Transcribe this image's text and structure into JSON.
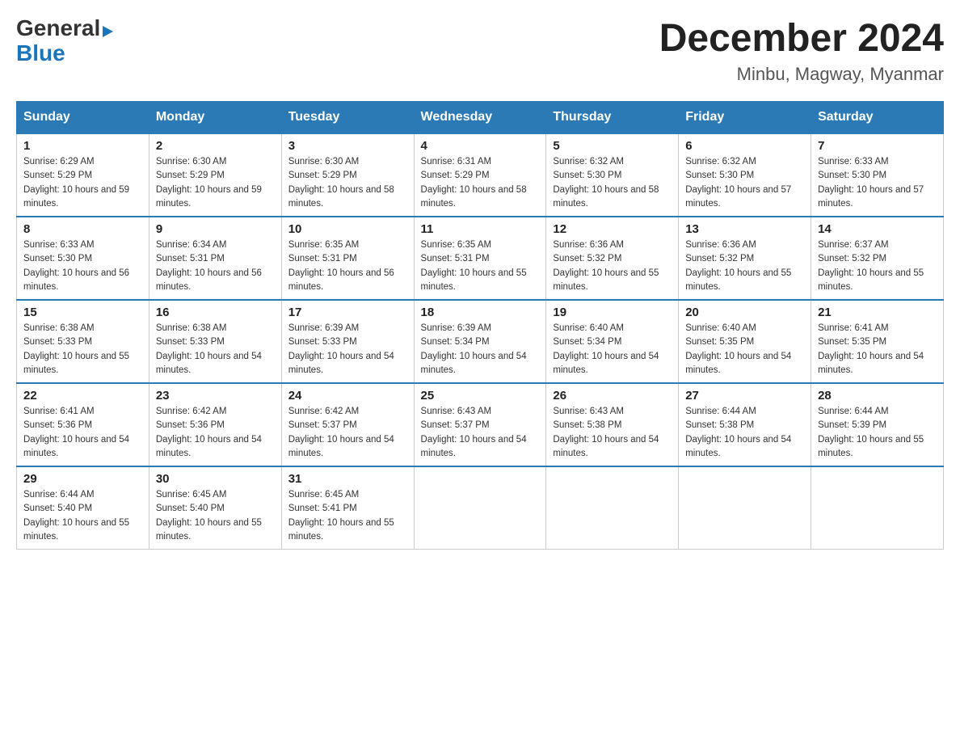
{
  "header": {
    "logo": {
      "general": "General",
      "arrow": "▶",
      "blue": "Blue"
    },
    "title": "December 2024",
    "location": "Minbu, Magway, Myanmar"
  },
  "weekdays": [
    "Sunday",
    "Monday",
    "Tuesday",
    "Wednesday",
    "Thursday",
    "Friday",
    "Saturday"
  ],
  "weeks": [
    [
      {
        "day": "1",
        "sunrise": "6:29 AM",
        "sunset": "5:29 PM",
        "daylight": "10 hours and 59 minutes."
      },
      {
        "day": "2",
        "sunrise": "6:30 AM",
        "sunset": "5:29 PM",
        "daylight": "10 hours and 59 minutes."
      },
      {
        "day": "3",
        "sunrise": "6:30 AM",
        "sunset": "5:29 PM",
        "daylight": "10 hours and 58 minutes."
      },
      {
        "day": "4",
        "sunrise": "6:31 AM",
        "sunset": "5:29 PM",
        "daylight": "10 hours and 58 minutes."
      },
      {
        "day": "5",
        "sunrise": "6:32 AM",
        "sunset": "5:30 PM",
        "daylight": "10 hours and 58 minutes."
      },
      {
        "day": "6",
        "sunrise": "6:32 AM",
        "sunset": "5:30 PM",
        "daylight": "10 hours and 57 minutes."
      },
      {
        "day": "7",
        "sunrise": "6:33 AM",
        "sunset": "5:30 PM",
        "daylight": "10 hours and 57 minutes."
      }
    ],
    [
      {
        "day": "8",
        "sunrise": "6:33 AM",
        "sunset": "5:30 PM",
        "daylight": "10 hours and 56 minutes."
      },
      {
        "day": "9",
        "sunrise": "6:34 AM",
        "sunset": "5:31 PM",
        "daylight": "10 hours and 56 minutes."
      },
      {
        "day": "10",
        "sunrise": "6:35 AM",
        "sunset": "5:31 PM",
        "daylight": "10 hours and 56 minutes."
      },
      {
        "day": "11",
        "sunrise": "6:35 AM",
        "sunset": "5:31 PM",
        "daylight": "10 hours and 55 minutes."
      },
      {
        "day": "12",
        "sunrise": "6:36 AM",
        "sunset": "5:32 PM",
        "daylight": "10 hours and 55 minutes."
      },
      {
        "day": "13",
        "sunrise": "6:36 AM",
        "sunset": "5:32 PM",
        "daylight": "10 hours and 55 minutes."
      },
      {
        "day": "14",
        "sunrise": "6:37 AM",
        "sunset": "5:32 PM",
        "daylight": "10 hours and 55 minutes."
      }
    ],
    [
      {
        "day": "15",
        "sunrise": "6:38 AM",
        "sunset": "5:33 PM",
        "daylight": "10 hours and 55 minutes."
      },
      {
        "day": "16",
        "sunrise": "6:38 AM",
        "sunset": "5:33 PM",
        "daylight": "10 hours and 54 minutes."
      },
      {
        "day": "17",
        "sunrise": "6:39 AM",
        "sunset": "5:33 PM",
        "daylight": "10 hours and 54 minutes."
      },
      {
        "day": "18",
        "sunrise": "6:39 AM",
        "sunset": "5:34 PM",
        "daylight": "10 hours and 54 minutes."
      },
      {
        "day": "19",
        "sunrise": "6:40 AM",
        "sunset": "5:34 PM",
        "daylight": "10 hours and 54 minutes."
      },
      {
        "day": "20",
        "sunrise": "6:40 AM",
        "sunset": "5:35 PM",
        "daylight": "10 hours and 54 minutes."
      },
      {
        "day": "21",
        "sunrise": "6:41 AM",
        "sunset": "5:35 PM",
        "daylight": "10 hours and 54 minutes."
      }
    ],
    [
      {
        "day": "22",
        "sunrise": "6:41 AM",
        "sunset": "5:36 PM",
        "daylight": "10 hours and 54 minutes."
      },
      {
        "day": "23",
        "sunrise": "6:42 AM",
        "sunset": "5:36 PM",
        "daylight": "10 hours and 54 minutes."
      },
      {
        "day": "24",
        "sunrise": "6:42 AM",
        "sunset": "5:37 PM",
        "daylight": "10 hours and 54 minutes."
      },
      {
        "day": "25",
        "sunrise": "6:43 AM",
        "sunset": "5:37 PM",
        "daylight": "10 hours and 54 minutes."
      },
      {
        "day": "26",
        "sunrise": "6:43 AM",
        "sunset": "5:38 PM",
        "daylight": "10 hours and 54 minutes."
      },
      {
        "day": "27",
        "sunrise": "6:44 AM",
        "sunset": "5:38 PM",
        "daylight": "10 hours and 54 minutes."
      },
      {
        "day": "28",
        "sunrise": "6:44 AM",
        "sunset": "5:39 PM",
        "daylight": "10 hours and 55 minutes."
      }
    ],
    [
      {
        "day": "29",
        "sunrise": "6:44 AM",
        "sunset": "5:40 PM",
        "daylight": "10 hours and 55 minutes."
      },
      {
        "day": "30",
        "sunrise": "6:45 AM",
        "sunset": "5:40 PM",
        "daylight": "10 hours and 55 minutes."
      },
      {
        "day": "31",
        "sunrise": "6:45 AM",
        "sunset": "5:41 PM",
        "daylight": "10 hours and 55 minutes."
      },
      null,
      null,
      null,
      null
    ]
  ]
}
